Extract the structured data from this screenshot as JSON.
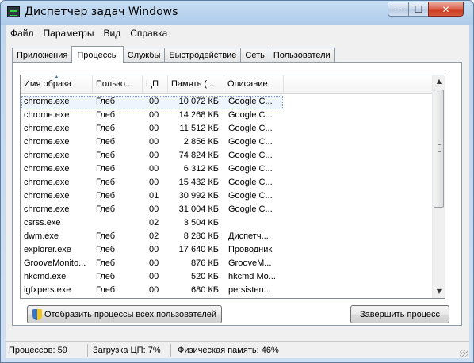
{
  "window": {
    "title": "Диспетчер задач Windows",
    "accent_color": "#aecbea",
    "buttons": {
      "minimize": "—",
      "maximize": "☐",
      "close": "✕"
    }
  },
  "menu": [
    "Файл",
    "Параметры",
    "Вид",
    "Справка"
  ],
  "menu_underline": [
    "Ф",
    "П",
    "В",
    "С"
  ],
  "tabs": [
    {
      "label": "Приложения",
      "active": false
    },
    {
      "label": "Процессы",
      "active": true
    },
    {
      "label": "Службы",
      "active": false
    },
    {
      "label": "Быстродействие",
      "active": false
    },
    {
      "label": "Сеть",
      "active": false
    },
    {
      "label": "Пользователи",
      "active": false
    }
  ],
  "table": {
    "headers": [
      "Имя образа",
      "Пользо...",
      "ЦП",
      "Память (...",
      "Описание"
    ],
    "sorted_column": "Имя образа",
    "rows": [
      [
        "chrome.exe",
        "Глеб",
        "00",
        "10 072 КБ",
        "Google C..."
      ],
      [
        "chrome.exe",
        "Глеб",
        "00",
        "14 268 КБ",
        "Google C..."
      ],
      [
        "chrome.exe",
        "Глеб",
        "00",
        "11 512 КБ",
        "Google C..."
      ],
      [
        "chrome.exe",
        "Глеб",
        "00",
        "2 856 КБ",
        "Google C..."
      ],
      [
        "chrome.exe",
        "Глеб",
        "00",
        "74 824 КБ",
        "Google C..."
      ],
      [
        "chrome.exe",
        "Глеб",
        "00",
        "6 312 КБ",
        "Google C..."
      ],
      [
        "chrome.exe",
        "Глеб",
        "00",
        "15 432 КБ",
        "Google C..."
      ],
      [
        "chrome.exe",
        "Глеб",
        "01",
        "30 992 КБ",
        "Google C..."
      ],
      [
        "chrome.exe",
        "Глеб",
        "00",
        "31 004 КБ",
        "Google C..."
      ],
      [
        "csrss.exe",
        "",
        "02",
        "3 504 КБ",
        ""
      ],
      [
        "dwm.exe",
        "Глеб",
        "02",
        "8 280 КБ",
        "Диспетч..."
      ],
      [
        "explorer.exe",
        "Глеб",
        "00",
        "17 640 КБ",
        "Проводник"
      ],
      [
        "GrooveMonito...",
        "Глеб",
        "00",
        "876 КБ",
        "GrooveM..."
      ],
      [
        "hkcmd.exe",
        "Глеб",
        "00",
        "520 КБ",
        "hkcmd Mo..."
      ],
      [
        "igfxpers.exe",
        "Глеб",
        "00",
        "680 КБ",
        "persisten..."
      ]
    ],
    "selected_row": 0
  },
  "buttons": {
    "show_all": "Отобразить процессы всех пользователей",
    "end_process": "Завершить процесс"
  },
  "status": {
    "processes": "Процессов: 59",
    "cpu": "Загрузка ЦП: 7%",
    "memory": "Физическая память: 46%"
  }
}
